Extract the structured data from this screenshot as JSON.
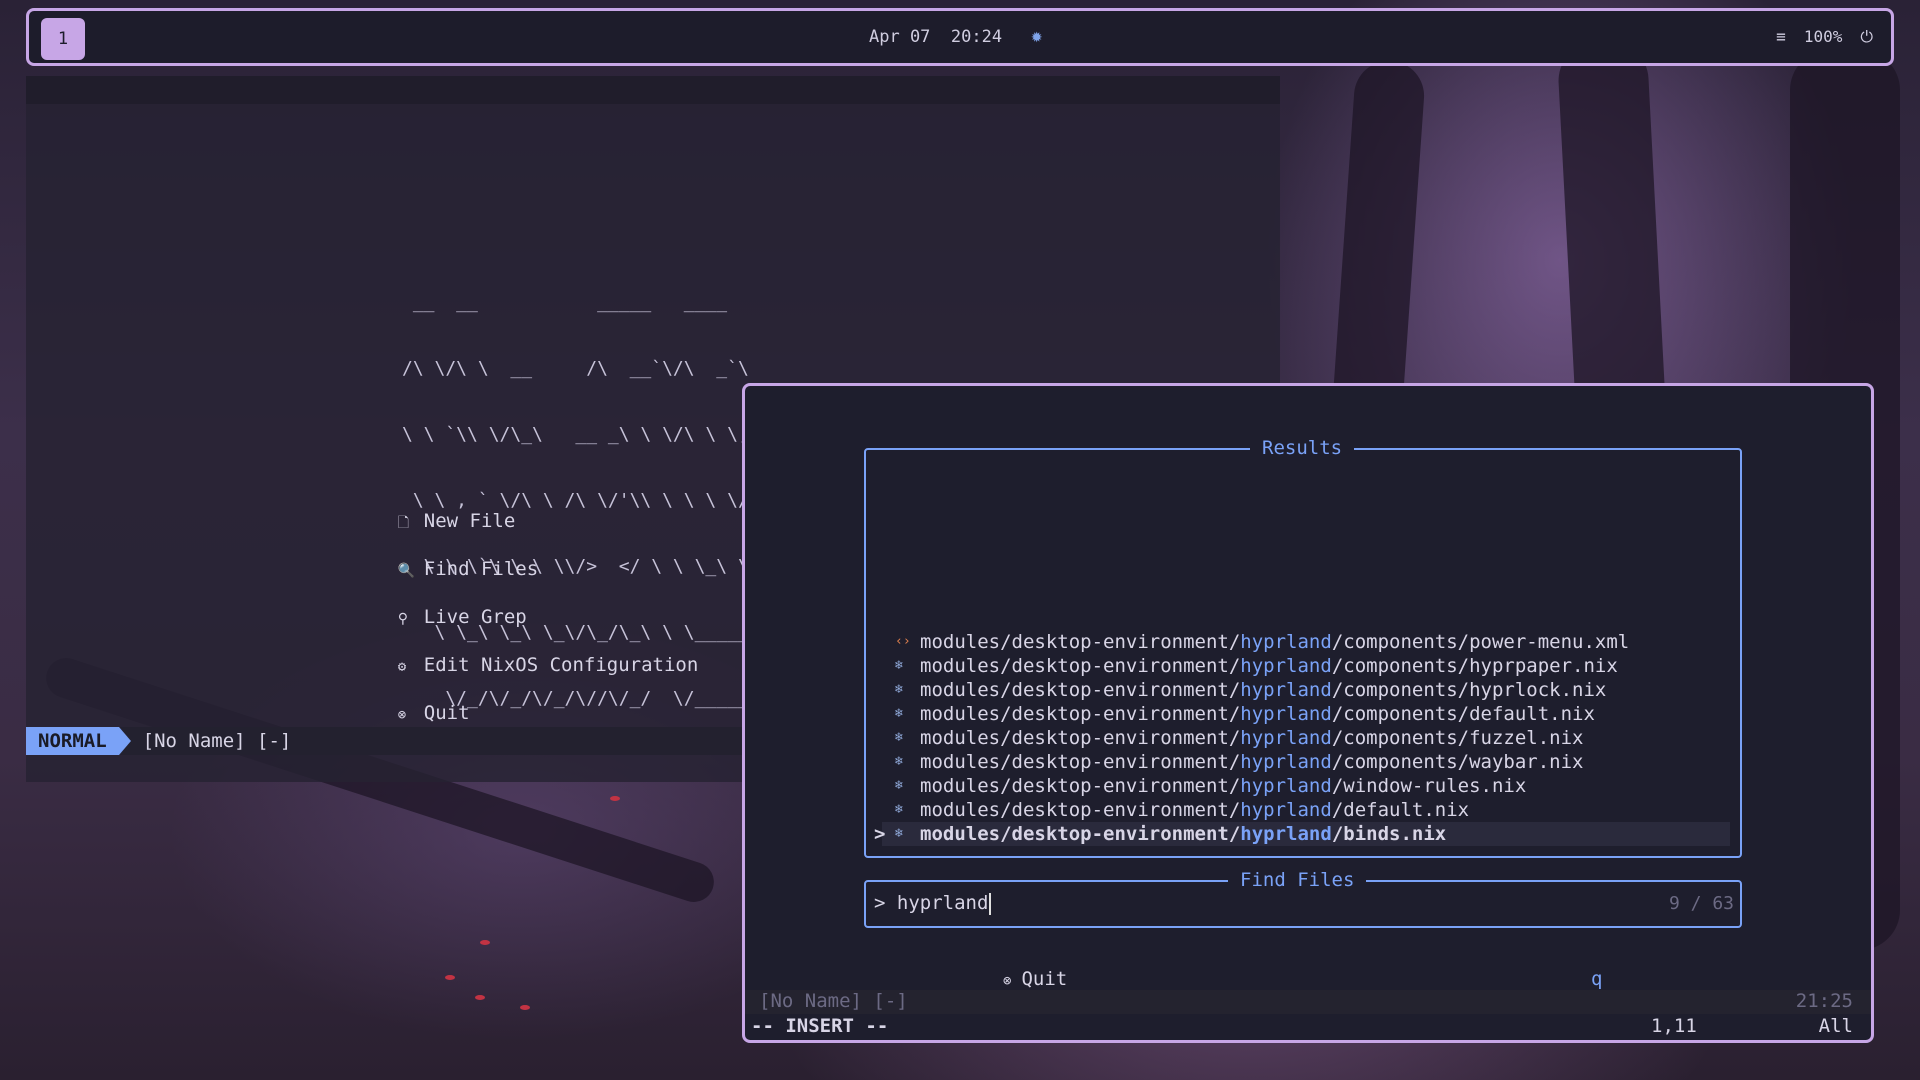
{
  "topbar": {
    "workspace": "1",
    "date": "Apr 07",
    "time": "20:24",
    "weather_icon": "sun-gear-icon",
    "menu_icon": "≡",
    "battery": "100%",
    "power_icon": "⏻"
  },
  "dashboard": {
    "ascii_art": [
      " __  __           _____   ____",
      "/\\ \\/\\ \\  __     /\\  __`\\/\\  _`\\",
      "\\ \\ `\\\\ \\/\\_\\   __ _\\ \\ \\/\\ \\ \\,\\L\\_\\",
      " \\ \\ , ` \\/\\ \\ /\\ \\/'\\\\ \\ \\ \\ \\/_\\__ \\",
      "  \\ \\ \\`\\ \\ \\ \\\\/>  </ \\ \\ \\_\\ \\/\\ \\L\\ \\",
      "   \\ \\_\\ \\_\\ \\_\\/\\_/\\_\\ \\ \\_____\\ `\\____\\",
      "    \\/_/\\/_/\\/_/\\//\\/_/  \\/_____/\\/_____/"
    ],
    "items": [
      {
        "icon": "🗋",
        "label": "New File"
      },
      {
        "icon": "🔍",
        "label": "Find Files"
      },
      {
        "icon": "⚲",
        "label": "Live Grep"
      },
      {
        "icon": "⚙",
        "label": "Edit NixOS Configuration"
      },
      {
        "icon": "⊗",
        "label": "Quit"
      }
    ],
    "status": {
      "mode": "NORMAL",
      "buffer": "[No Name] [-]"
    }
  },
  "finder": {
    "results_title": "Results",
    "results": [
      {
        "icon": "‹›",
        "prefix": "modules/desktop-environment/",
        "match": "hyprland",
        "suffix": "/components/power-menu.xml"
      },
      {
        "icon": "❄",
        "prefix": "modules/desktop-environment/",
        "match": "hyprland",
        "suffix": "/components/hyprpaper.nix"
      },
      {
        "icon": "❄",
        "prefix": "modules/desktop-environment/",
        "match": "hyprland",
        "suffix": "/components/hyprlock.nix"
      },
      {
        "icon": "❄",
        "prefix": "modules/desktop-environment/",
        "match": "hyprland",
        "suffix": "/components/default.nix"
      },
      {
        "icon": "❄",
        "prefix": "modules/desktop-environment/",
        "match": "hyprland",
        "suffix": "/components/fuzzel.nix"
      },
      {
        "icon": "❄",
        "prefix": "modules/desktop-environment/",
        "match": "hyprland",
        "suffix": "/components/waybar.nix"
      },
      {
        "icon": "❄",
        "prefix": "modules/desktop-environment/",
        "match": "hyprland",
        "suffix": "/window-rules.nix"
      },
      {
        "icon": "❄",
        "prefix": "modules/desktop-environment/",
        "match": "hyprland",
        "suffix": "/default.nix"
      },
      {
        "icon": "❄",
        "prefix": "modules/desktop-environment/",
        "match": "hyprland",
        "suffix": "/binds.nix"
      }
    ],
    "selected_caret": ">",
    "prompt_title": "Find Files",
    "prompt_symbol": ">",
    "query": "hyprland",
    "count": "9 / 63",
    "quit_label": "Quit",
    "quit_icon": "⊗",
    "quit_key": "q",
    "status_buffer": "[No Name] [-]",
    "status_time": "21:25",
    "mode": "-- INSERT --",
    "position": "1,11",
    "scroll": "All"
  },
  "colors": {
    "accent": "#c7a6e6",
    "blue": "#7aa2f7",
    "bg": "#1e1e2d"
  }
}
